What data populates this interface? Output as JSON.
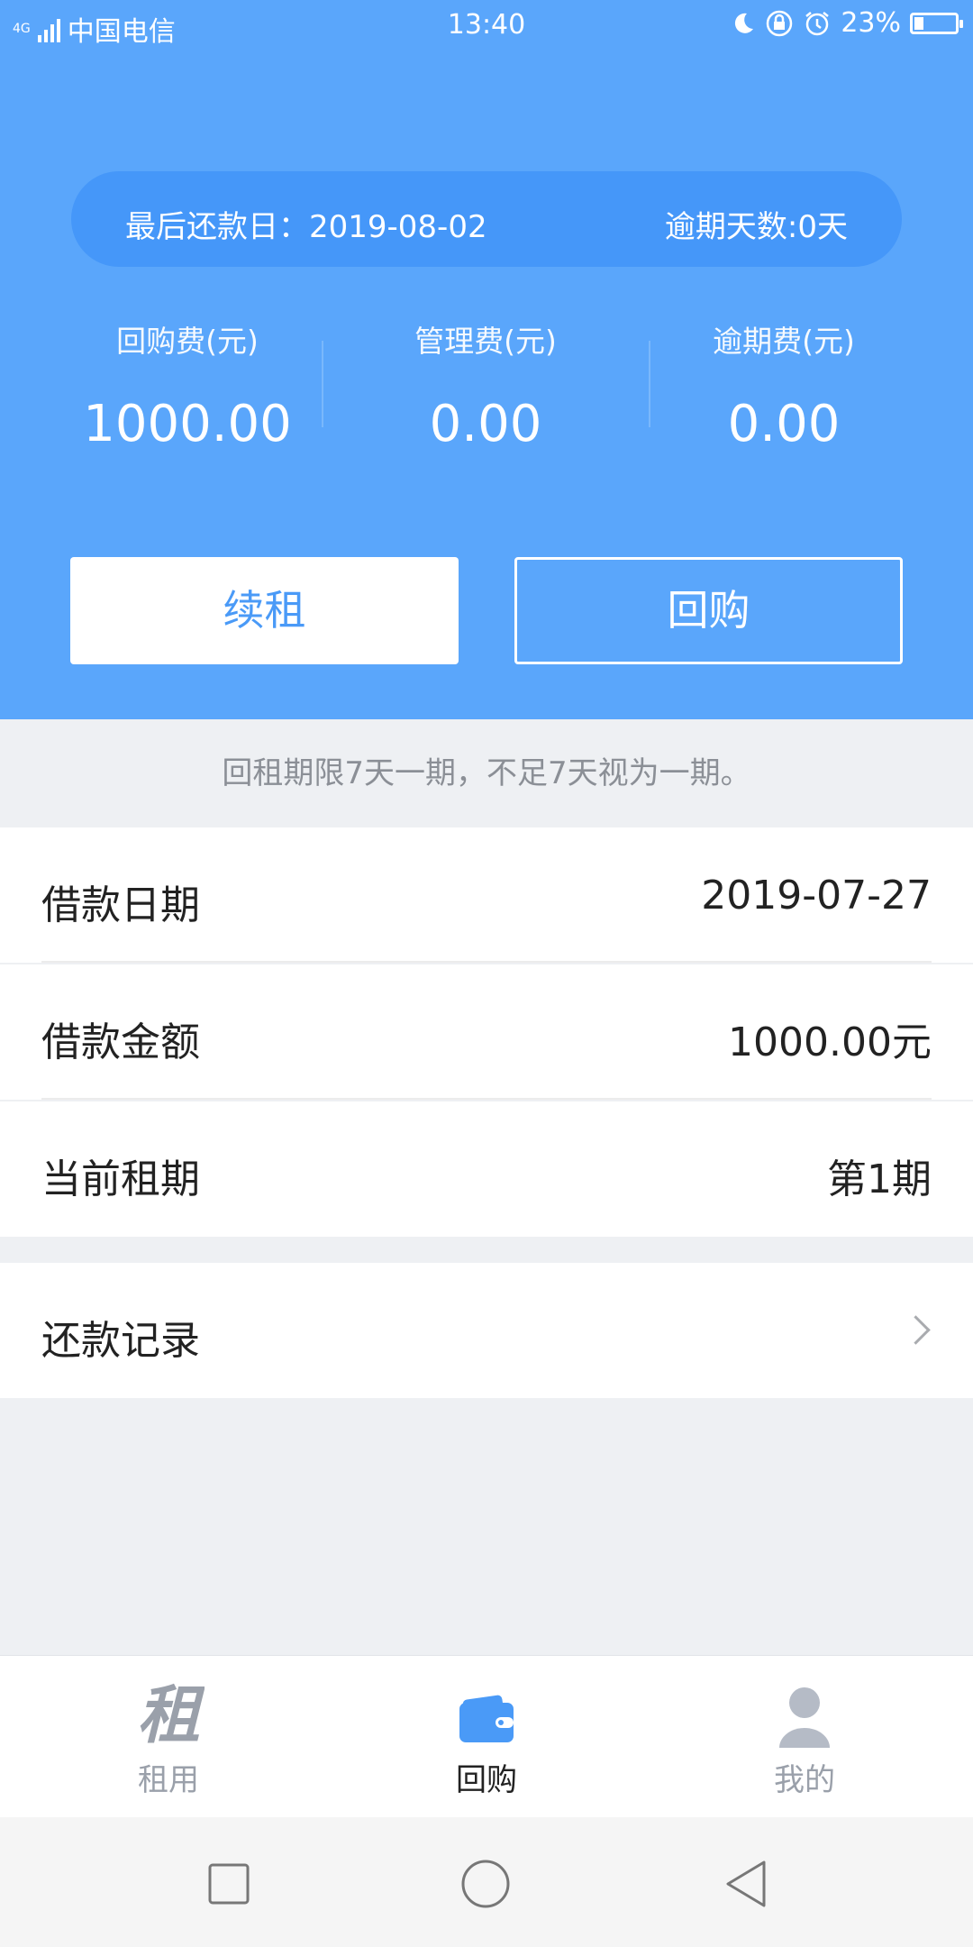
{
  "status_bar": {
    "network": "4G",
    "carrier": "中国电信",
    "time": "13:40",
    "battery": "23%",
    "battery_level": 0.23
  },
  "summary": {
    "due_date_label": "最后还款日：2019-08-02",
    "overdue_days_label": "逾期天数:0天"
  },
  "fees": [
    {
      "label": "回购费(元)",
      "value": "1000.00"
    },
    {
      "label": "管理费(元)",
      "value": "0.00"
    },
    {
      "label": "逾期费(元)",
      "value": "0.00"
    }
  ],
  "actions": {
    "renew_label": "续租",
    "buyback_label": "回购"
  },
  "note": "回租期限7天一期，不足7天视为一期。",
  "details": [
    {
      "label": "借款日期",
      "value": "2019-07-27"
    },
    {
      "label": "借款金额",
      "value": "1000.00元"
    },
    {
      "label": "当前租期",
      "value": "第1期"
    }
  ],
  "repayment_record": {
    "label": "还款记录"
  },
  "tabs": [
    {
      "label": "租用",
      "icon": "rent-icon",
      "active": false
    },
    {
      "label": "回购",
      "icon": "wallet-icon",
      "active": true
    },
    {
      "label": "我的",
      "icon": "user-icon",
      "active": false
    }
  ],
  "colors": {
    "primary": "#5aa6fb",
    "pill": "#4597f9",
    "active_tab": "#222222",
    "inactive_tab": "#9aa0aa"
  }
}
